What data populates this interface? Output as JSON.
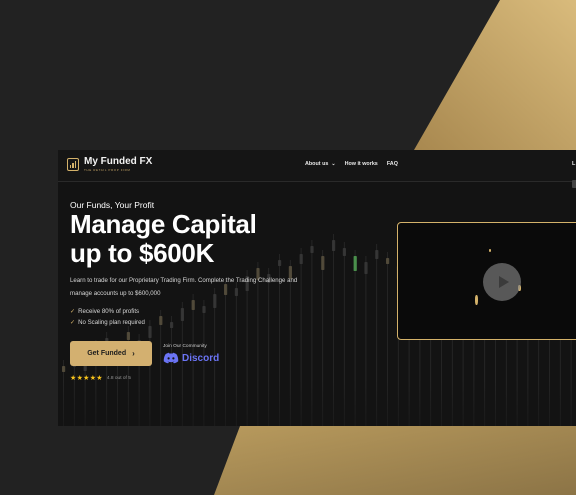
{
  "colors": {
    "background": "#222222",
    "gold": "#d3b070",
    "site_background": "#131313",
    "discord": "#6b74f5",
    "stars": "#f6c21b",
    "candle_green": "#4a8f4c"
  },
  "logo": {
    "icon": "chart-bars-icon",
    "name": "My Funded FX",
    "subtitle": "THE RETAIL PROP FIRM"
  },
  "nav": {
    "about_label": "About us",
    "about_icon": "chevron-down-icon",
    "how_label": "How it works",
    "faq_label": "FAQ",
    "login_label": "L"
  },
  "hero": {
    "tagline": "Our Funds, Your Profit",
    "headline_line1": "Manage Capital",
    "headline_line2": "up to $600K",
    "description": "Learn to trade for our Proprietary Trading Firm. Complete the Trading Challenge and manage accounts up to $600,000",
    "bullets": [
      "Receive 80% of profits",
      "No Scaling plan required"
    ]
  },
  "cta": {
    "label": "Get Funded",
    "icon": "chevron-right-icon"
  },
  "community": {
    "label": "Join Our Community",
    "brand": "Discord",
    "icon": "discord-icon"
  },
  "rating": {
    "stars": "★★★★★",
    "text": "4.8 out of 5"
  },
  "video": {
    "icon": "play-icon"
  }
}
